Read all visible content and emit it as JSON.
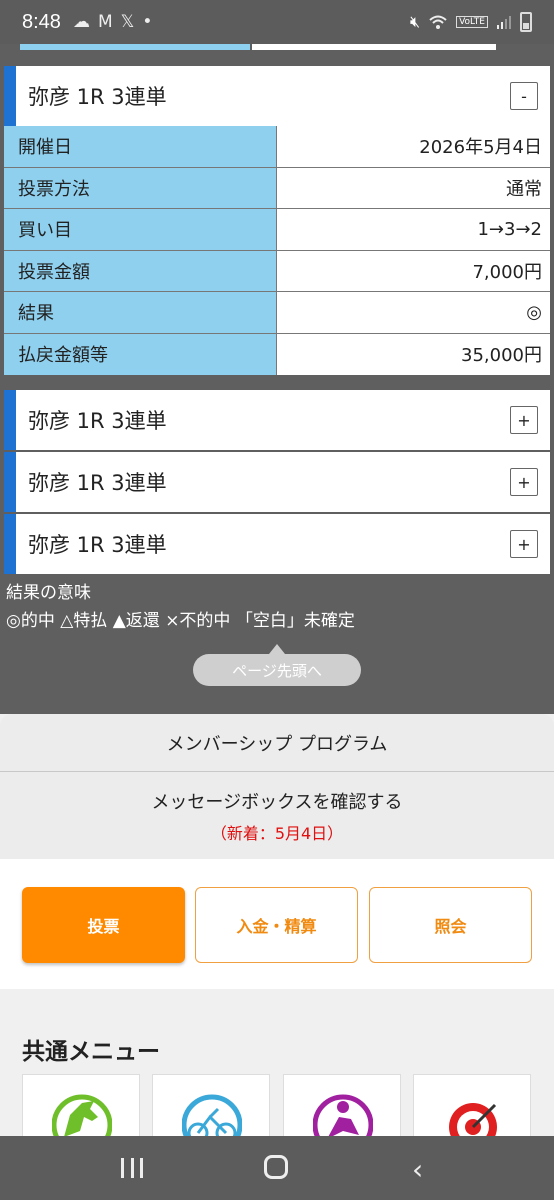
{
  "status_bar": {
    "time": "8:48",
    "left_icons": [
      "cloud-icon",
      "gmail-icon",
      "x-icon",
      "dot-icon"
    ],
    "right_icons": [
      "mute-icon",
      "wifi-icon",
      "volte-icon",
      "signal-icon",
      "battery-icon"
    ],
    "volte_label": "VoLTE"
  },
  "cards": [
    {
      "title": "弥彦 1R 3連単",
      "toggle": "-"
    },
    {
      "title": "弥彦 1R 3連単",
      "toggle": "+"
    },
    {
      "title": "弥彦 1R 3連単",
      "toggle": "+"
    },
    {
      "title": "弥彦 1R 3連単",
      "toggle": "+"
    }
  ],
  "detail_rows": [
    {
      "label": "開催日",
      "value": "2026年5月4日"
    },
    {
      "label": "投票方法",
      "value": "通常"
    },
    {
      "label": "買い目",
      "value": "1→3→2"
    },
    {
      "label": "投票金額",
      "value": "7,000円"
    },
    {
      "label": "結果",
      "value": "◎"
    },
    {
      "label": "払戻金額等",
      "value": "35,000円"
    }
  ],
  "legend": {
    "title": "結果の意味",
    "text": "◎的中 △特払 ▲返還 ×不的中 「空白」未確定"
  },
  "page_top_label": "ページ先頭へ",
  "panel": {
    "membership": "メンバーシップ プログラム",
    "message_box": "メッセージボックスを確認する",
    "new_notice": "（新着：5月4日）"
  },
  "buttons": {
    "vote": "投票",
    "deposit": "入金・精算",
    "inquiry": "照会"
  },
  "common_menu": {
    "title": "共通メニュー",
    "tiles": [
      "horse-icon",
      "cyclist-icon",
      "motorcycle-racer-icon",
      "target-icon"
    ]
  },
  "colors": {
    "accent_blue": "#1e73d2",
    "label_blue": "#8fd0ef",
    "orange": "#ff8a00",
    "red": "#e01010"
  }
}
